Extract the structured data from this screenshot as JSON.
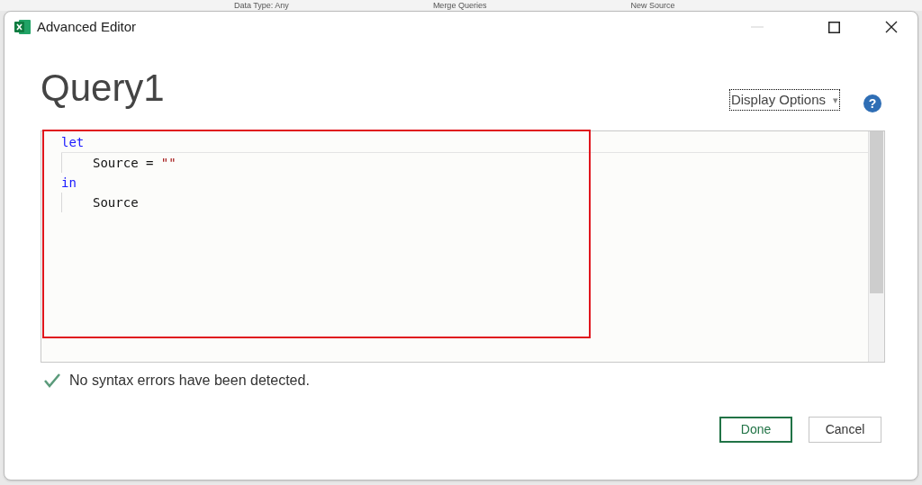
{
  "background_ribbon": [
    "Data Type: Any",
    "Merge Queries",
    "New Source"
  ],
  "window": {
    "title": "Advanced Editor"
  },
  "query_name": "Query1",
  "display_options": {
    "label": "Display Options",
    "caret": "▾"
  },
  "help": {
    "label": "?"
  },
  "editor": {
    "lines": [
      {
        "indented": false,
        "tokens": [
          {
            "text": "let",
            "kind": "keyword"
          }
        ]
      },
      {
        "indented": true,
        "tokens": [
          {
            "text": "Source = ",
            "kind": "plain"
          },
          {
            "text": "\"\"",
            "kind": "string"
          }
        ]
      },
      {
        "indented": false,
        "tokens": [
          {
            "text": "in",
            "kind": "keyword"
          }
        ]
      },
      {
        "indented": true,
        "tokens": [
          {
            "text": "Source",
            "kind": "plain"
          }
        ]
      }
    ]
  },
  "status": "No syntax errors have been detected.",
  "buttons": [
    {
      "label": "Done",
      "primary": true
    },
    {
      "label": "Cancel",
      "primary": false
    }
  ]
}
